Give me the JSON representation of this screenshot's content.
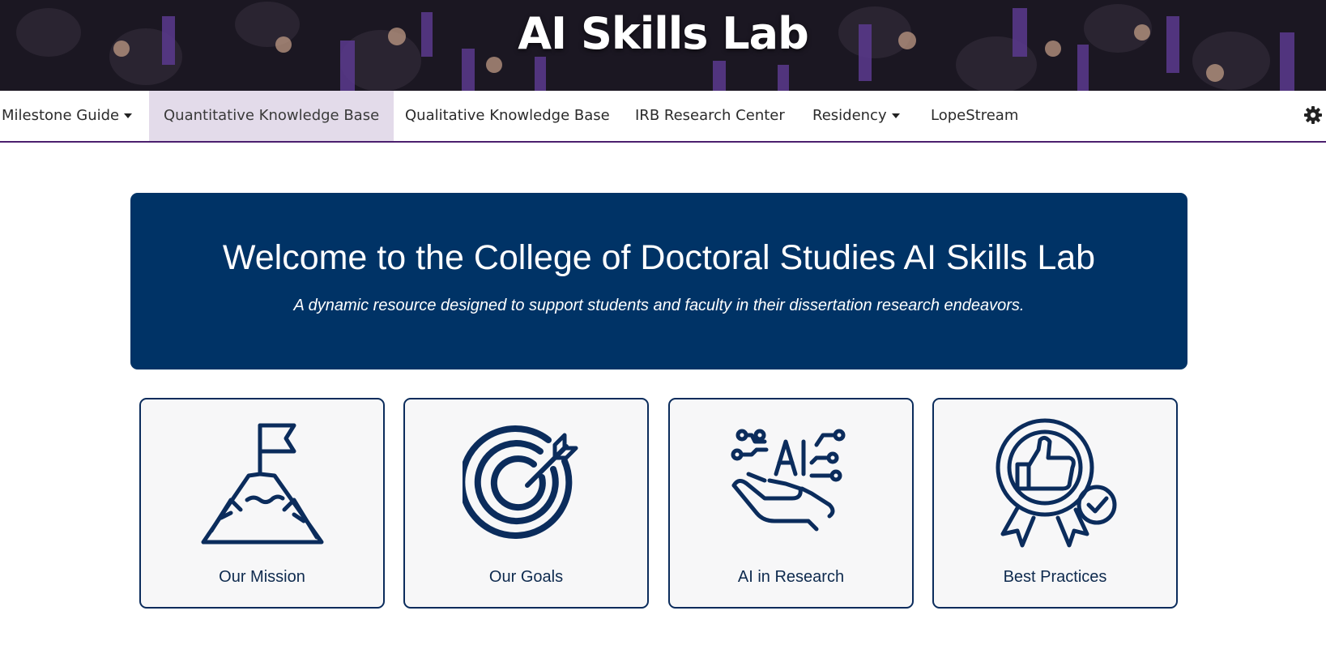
{
  "hero": {
    "title": "AI Skills Lab"
  },
  "nav": {
    "items": [
      {
        "label": "Milestone Guide",
        "dropdown": true,
        "active": false
      },
      {
        "label": "Quantitative Knowledge Base",
        "dropdown": false,
        "active": true
      },
      {
        "label": "Qualitative Knowledge Base",
        "dropdown": false,
        "active": false
      },
      {
        "label": "IRB Research Center",
        "dropdown": false,
        "active": false
      },
      {
        "label": "Residency",
        "dropdown": true,
        "active": false
      },
      {
        "label": "LopeStream",
        "dropdown": false,
        "active": false
      }
    ],
    "settings_icon": "gear-icon"
  },
  "welcome": {
    "title": "Welcome to the College of Doctoral Studies AI Skills Lab",
    "subtitle": "A dynamic resource designed to support students and faculty in their dissertation research endeavors."
  },
  "cards": [
    {
      "label": "Our Mission",
      "icon": "mountain-flag-icon"
    },
    {
      "label": "Our Goals",
      "icon": "target-arrow-icon"
    },
    {
      "label": "AI in Research",
      "icon": "ai-hand-icon"
    },
    {
      "label": "Best Practices",
      "icon": "award-thumbs-up-icon"
    }
  ],
  "colors": {
    "primary_navy": "#003366",
    "icon_navy": "#0b2c5c",
    "nav_active_bg": "#e3dbea",
    "nav_border": "#4b1f6e",
    "hero_dark": "#1e1a26",
    "gown_purple": "#5b3a8e"
  }
}
